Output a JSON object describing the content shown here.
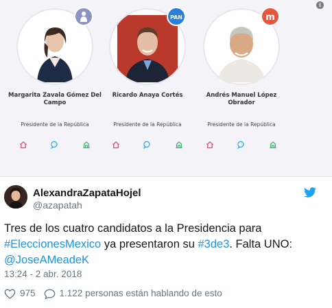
{
  "embedded_image": {
    "info_icon": "info-icon",
    "candidates": [
      {
        "name": "Margarita Zavala Gómez Del Campo",
        "role": "Presidente de la República",
        "party_label": "",
        "party_color": "#8a93c4"
      },
      {
        "name": "Ricardo Anaya Cortés",
        "role": "Presidente de la República",
        "party_label": "PAN",
        "party_color": "#2a7fd8"
      },
      {
        "name": "Andrés Manuel López Obrador",
        "role": "Presidente de la República",
        "party_label": "m",
        "party_color": "#e8553f"
      }
    ],
    "action_icons": [
      "home-icon",
      "chat-bubble-icon",
      "building-icon"
    ],
    "action_colors": {
      "home": "#e0457b",
      "chat": "#2aa7e0",
      "building": "#39b36a"
    }
  },
  "tweet": {
    "display_name": "AlexandraZapataHojel",
    "handle": "@azapatah",
    "text_plain_1": "Tres de los cuatro candidatos a la Presidencia para",
    "hashtag_1": "#EleccionesMexico",
    "text_plain_2": " ya presentaron su ",
    "hashtag_2": "#3de3",
    "text_plain_3": ". Falta UNO:",
    "mention": "@JoseAMeadeK",
    "timestamp": "13:24 - 2 abr. 2018",
    "likes": "975",
    "conversation": "1.122 personas están hablando de esto",
    "colors": {
      "link": "#1b95e0",
      "muted": "#657786",
      "twitter_blue": "#1da1f2"
    }
  }
}
